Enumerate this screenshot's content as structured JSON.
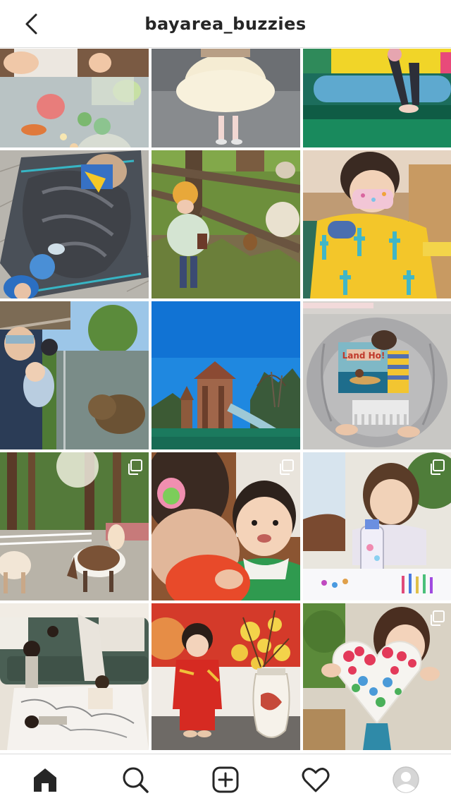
{
  "header": {
    "title": "bayarea_buzzies",
    "back_icon": "chevron-left-icon"
  },
  "grid": {
    "posts": [
      {
        "subject": "sensory play tray",
        "multi": false
      },
      {
        "subject": "tutu skirt",
        "multi": false
      },
      {
        "subject": "playground bench",
        "multi": false
      },
      {
        "subject": "wagon nap",
        "multi": false
      },
      {
        "subject": "farm fence walk",
        "multi": false
      },
      {
        "subject": "cactus sweater",
        "multi": false
      },
      {
        "subject": "zoo bear exhibit",
        "multi": false
      },
      {
        "subject": "playground tower",
        "multi": false
      },
      {
        "subject": "reading in chair",
        "multi": false,
        "book_title": "Land Ho!"
      },
      {
        "subject": "pony ride",
        "multi": true
      },
      {
        "subject": "toddler close-up",
        "multi": true
      },
      {
        "subject": "water bottle art",
        "multi": true
      },
      {
        "subject": "living room map",
        "multi": false
      },
      {
        "subject": "lunar new year",
        "multi": false
      },
      {
        "subject": "heart handprint",
        "multi": true
      }
    ]
  },
  "tabbar": {
    "items": [
      "home-icon",
      "search-icon",
      "new-post-icon",
      "activity-heart-icon",
      "profile-avatar-icon"
    ],
    "active": "home-icon"
  },
  "colors": {
    "text": "#262626",
    "border": "#dbdbdb",
    "background": "#ffffff"
  }
}
